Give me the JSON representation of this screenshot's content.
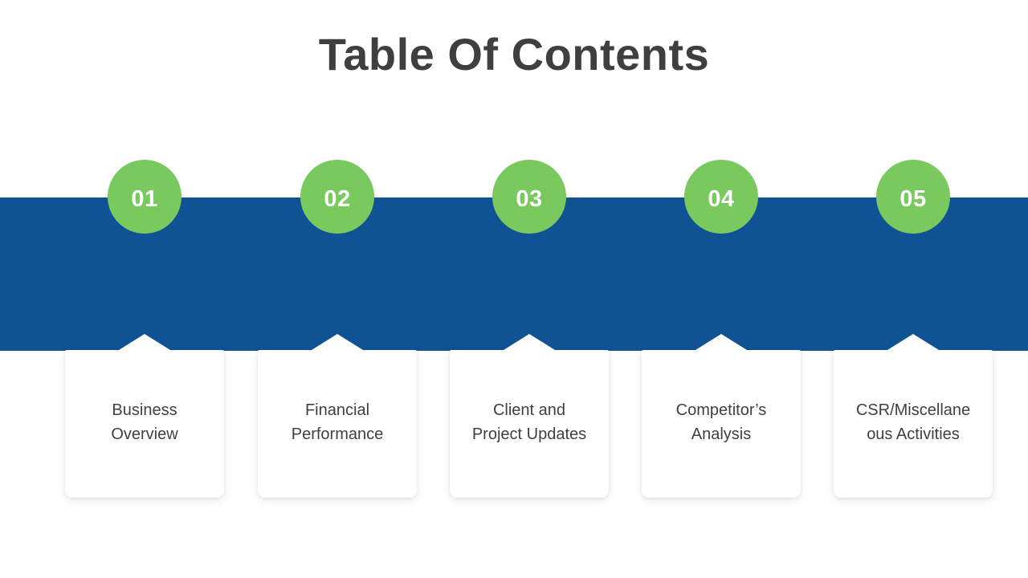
{
  "slide": {
    "title": "Table Of Contents",
    "background_color": "#ffffff",
    "band_color": "#0f5395",
    "circle_color": "#79c95f",
    "title_color": "#3f3f3f",
    "card_color": "#ffffff",
    "card_text_color": "#404040"
  },
  "items": [
    {
      "number": "01",
      "label_line1": "Business",
      "label_line2": "Overview",
      "label_full": "Business Overview"
    },
    {
      "number": "02",
      "label_line1": "Financial",
      "label_line2": "Performance",
      "label_full": "Financial Performance"
    },
    {
      "number": "03",
      "label_line1": "Client and",
      "label_line2": "Project Updates",
      "label_full": "Client and Project Updates"
    },
    {
      "number": "04",
      "label_line1": "Competitor’s",
      "label_line2": "Analysis",
      "label_full": "Competitor’s Analysis"
    },
    {
      "number": "05",
      "label_line1": "CSR/Miscellane",
      "label_line2": "ous Activities",
      "label_full": "CSR/Miscellaneous Activities"
    }
  ]
}
